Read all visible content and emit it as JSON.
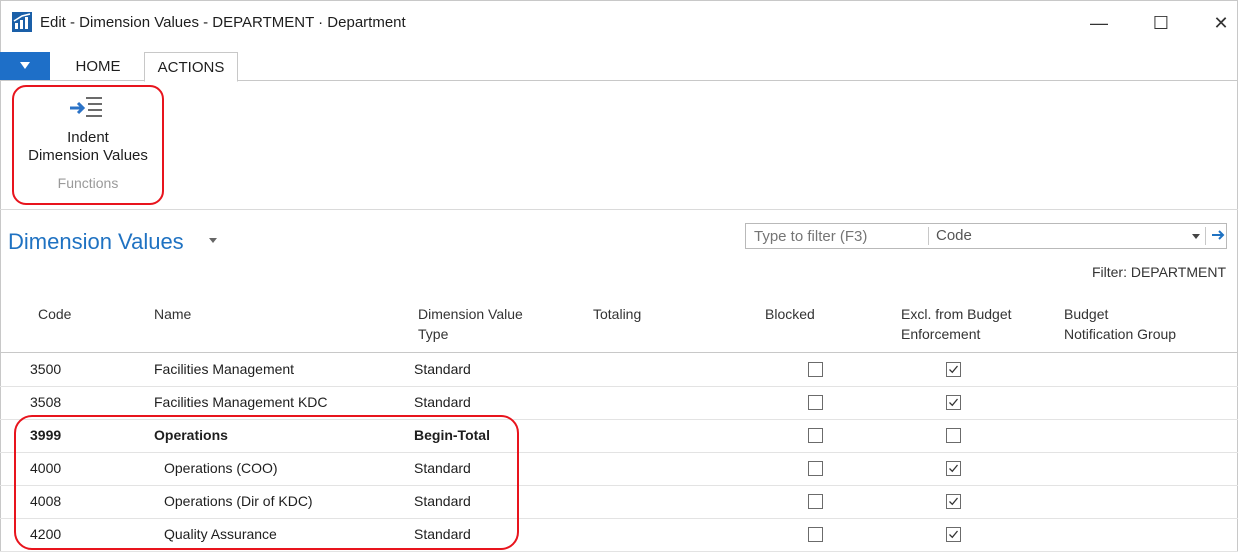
{
  "window": {
    "title": "Edit - Dimension Values - DEPARTMENT · Department",
    "minimize": "—",
    "maximize": "☐",
    "close": "✕"
  },
  "ribbon": {
    "tabs": [
      "HOME",
      "ACTIONS"
    ],
    "active_tab": "ACTIONS",
    "action": {
      "label_line1": "Indent",
      "label_line2": "Dimension Values",
      "icon": "indent-icon"
    },
    "group_label": "Functions"
  },
  "page": {
    "title": "Dimension Values",
    "filter_placeholder": "Type to filter (F3)",
    "filter_field": "Code",
    "filter_status": "Filter: DEPARTMENT"
  },
  "table": {
    "columns": [
      [
        "Code"
      ],
      [
        "Name"
      ],
      [
        "Dimension Value",
        "Type"
      ],
      [
        "Totaling"
      ],
      [
        "Blocked"
      ],
      [
        "Excl. from Budget",
        "Enforcement"
      ],
      [
        "Budget",
        "Notification Group"
      ]
    ],
    "rows": [
      {
        "code": "3500",
        "name": "Facilities Management",
        "type": "Standard",
        "blocked": false,
        "excl": true,
        "bold": false,
        "indent": false
      },
      {
        "code": "3508",
        "name": "Facilities Management KDC",
        "type": "Standard",
        "blocked": false,
        "excl": true,
        "bold": false,
        "indent": false
      },
      {
        "code": "3999",
        "name": "Operations",
        "type": "Begin-Total",
        "blocked": false,
        "excl": false,
        "bold": true,
        "indent": false
      },
      {
        "code": "4000",
        "name": "Operations (COO)",
        "type": "Standard",
        "blocked": false,
        "excl": true,
        "bold": false,
        "indent": true
      },
      {
        "code": "4008",
        "name": "Operations (Dir of KDC)",
        "type": "Standard",
        "blocked": false,
        "excl": true,
        "bold": false,
        "indent": true
      },
      {
        "code": "4200",
        "name": "Quality Assurance",
        "type": "Standard",
        "blocked": false,
        "excl": true,
        "bold": false,
        "indent": true
      }
    ]
  },
  "colors": {
    "accent": "#1f72c2",
    "highlight": "#e8141d",
    "app_menu": "#1e6fc8"
  }
}
